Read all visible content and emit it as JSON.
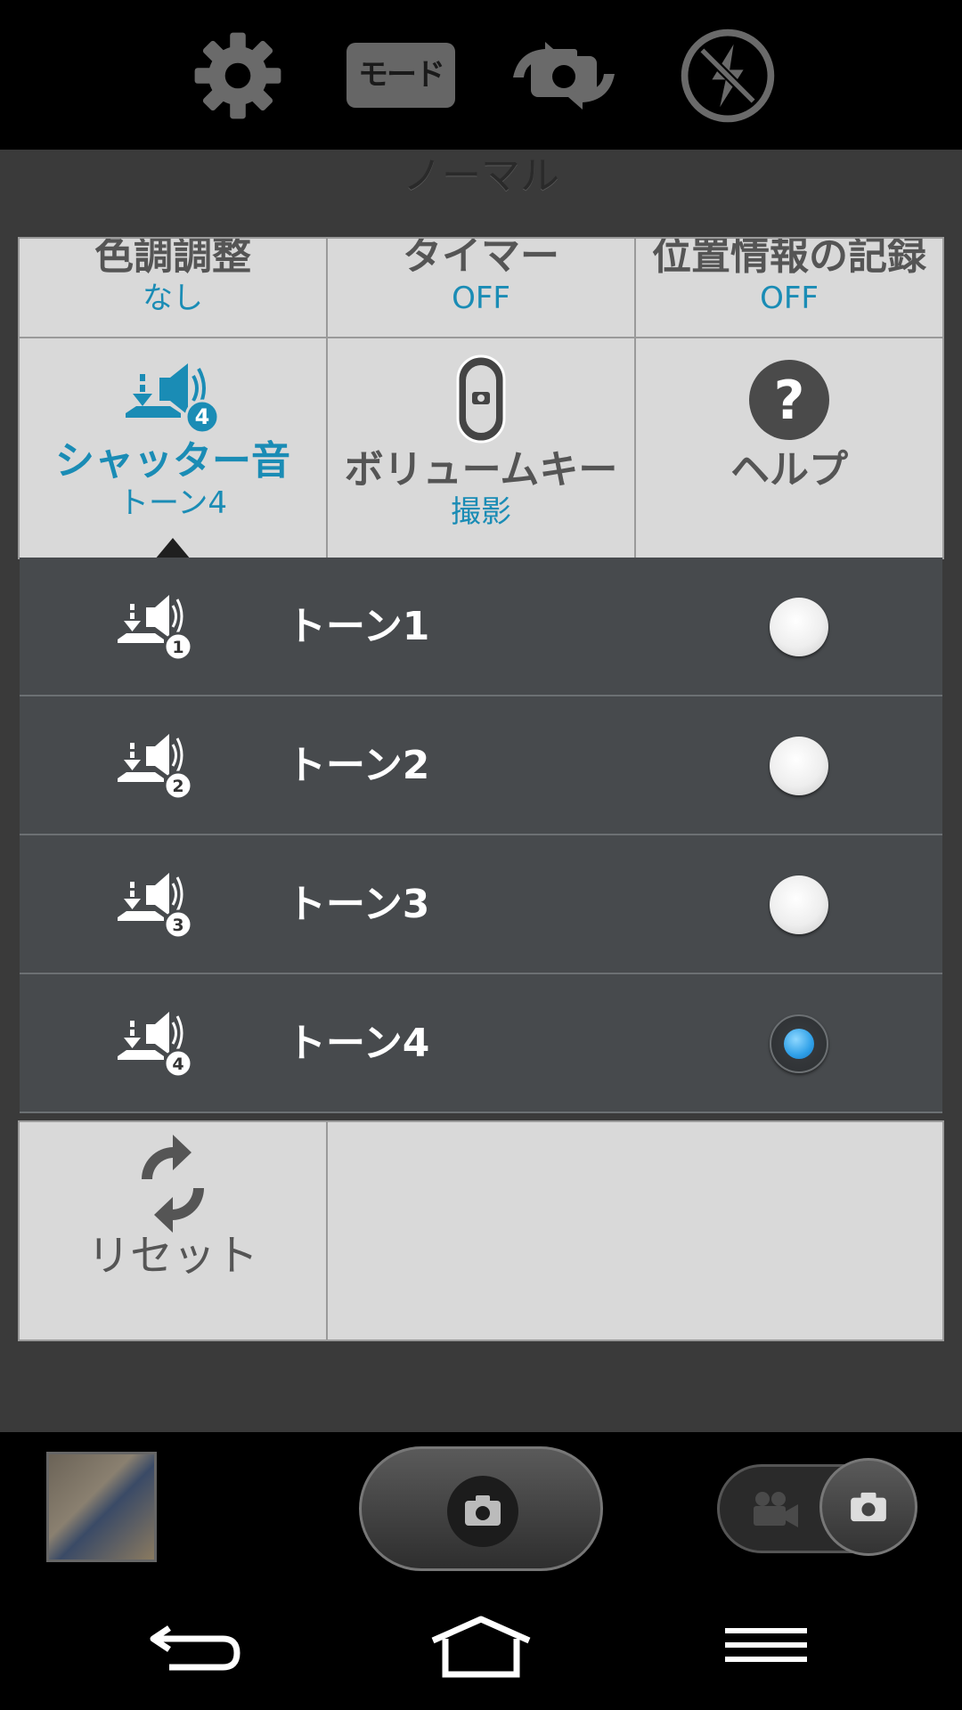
{
  "topbar": {
    "mode_button_label": "モード",
    "icons": [
      "gear-icon",
      "switch-camera-icon",
      "flash-off-icon"
    ]
  },
  "panel": {
    "mode_name": "ノーマル"
  },
  "settings": {
    "row1": [
      {
        "label": "色調調整",
        "value": "なし"
      },
      {
        "label": "タイマー",
        "value": "OFF"
      },
      {
        "label": "位置情報の記録",
        "value": "OFF"
      }
    ],
    "row2": [
      {
        "label": "シャッター音",
        "value": "トーン4",
        "icon": "shutter-sound-icon",
        "badge": "4"
      },
      {
        "label": "ボリュームキー",
        "value": "撮影",
        "icon": "volume-key-icon"
      },
      {
        "label": "ヘルプ",
        "value": "",
        "icon": "help-icon"
      }
    ],
    "reset_label": "リセット"
  },
  "tones": {
    "items": [
      {
        "label": "トーン1",
        "badge": "1",
        "selected": false
      },
      {
        "label": "トーン2",
        "badge": "2",
        "selected": false
      },
      {
        "label": "トーン3",
        "badge": "3",
        "selected": false
      },
      {
        "label": "トーン4",
        "badge": "4",
        "selected": true
      }
    ]
  },
  "colors": {
    "accent": "#1a8cb5",
    "radio_selected": "#2fa0e8",
    "panel_bg": "#3a3a3a",
    "cell_bg": "#d9d9d9",
    "list_bg": "#474a4d"
  }
}
